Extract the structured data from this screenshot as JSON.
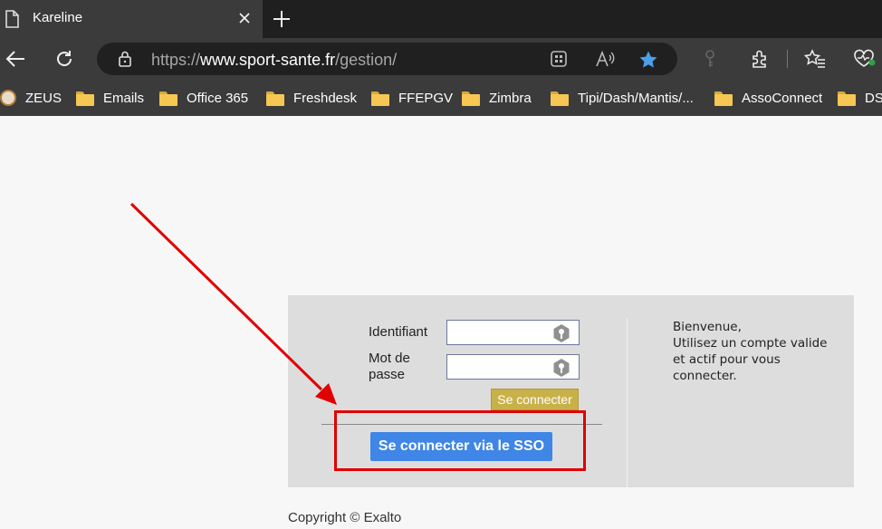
{
  "tab": {
    "title": "Kareline"
  },
  "address": {
    "scheme": "https://",
    "host": "www.sport-sante.fr",
    "path": "/gestion/"
  },
  "bookmarks": [
    {
      "label": "ZEUS",
      "icon": "zeus-icon"
    },
    {
      "label": "Emails",
      "icon": "folder-icon"
    },
    {
      "label": "Office 365",
      "icon": "folder-icon"
    },
    {
      "label": "Freshdesk",
      "icon": "folder-icon"
    },
    {
      "label": "FFEPGV",
      "icon": "folder-icon"
    },
    {
      "label": "Zimbra",
      "icon": "folder-icon"
    },
    {
      "label": "Tipi/Dash/Mantis/...",
      "icon": "folder-icon"
    },
    {
      "label": "AssoConnect",
      "icon": "folder-icon"
    },
    {
      "label": "DS",
      "icon": "folder-icon"
    }
  ],
  "login": {
    "username_label": "Identifiant",
    "password_label_line1": "Mot de",
    "password_label_line2": "passe",
    "username_value": "",
    "password_value": "",
    "submit_label": "Se connecter",
    "sso_label": "Se connecter via le SSO"
  },
  "welcome": {
    "line1": "Bienvenue,",
    "line2": "Utilisez un compte valide",
    "line3": "et actif pour vous",
    "line4": "connecter."
  },
  "footer": {
    "copyright": "Copyright © Exalto"
  },
  "colors": {
    "sso_button": "#3f86e6",
    "login_button": "#c9b14a",
    "highlight": "#e00000",
    "favorite_star": "#4c9ee8"
  }
}
